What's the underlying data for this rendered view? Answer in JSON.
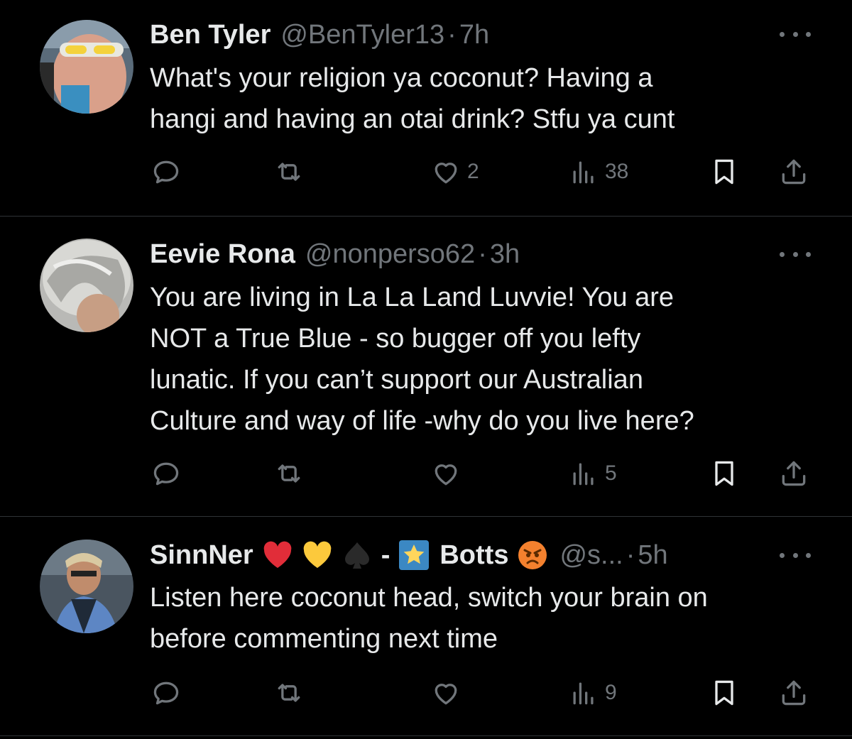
{
  "tweets": [
    {
      "name": "Ben Tyler",
      "handle": "@BenTyler13",
      "separator": "·",
      "time": "7h",
      "lines": [
        "What's your religion ya coconut? Having a",
        "hangi and having an otai drink? Stfu ya cunt"
      ],
      "likes": "2",
      "views": "38"
    },
    {
      "name": "Eevie Rona",
      "handle": "@nonperso62",
      "separator": "·",
      "time": "3h",
      "lines": [
        "You are living in La La Land Luvvie! You are",
        "NOT a True Blue - so bugger off you lefty",
        "lunatic. If you can’t support our Australian",
        "Culture and way of life -why do you live here?"
      ],
      "likes": "",
      "views": "5"
    },
    {
      "name_part1": "SinnNer",
      "name_dash": "-",
      "name_part2": "Botts",
      "name_emojis": [
        "red-heart",
        "yellow-heart",
        "spade-suit",
        "glowing-star",
        "angry-face"
      ],
      "handle": "@s...",
      "separator": "·",
      "time": "5h",
      "lines": [
        "Listen here coconut head, switch your brain on",
        "before commenting next time"
      ],
      "likes": "",
      "views": "9"
    }
  ],
  "icons": {
    "reply": "reply-icon",
    "retweet": "retweet-icon",
    "like": "heart-icon",
    "views": "views-icon",
    "bookmark": "bookmark-icon",
    "share": "share-icon",
    "more": "more-icon"
  },
  "colors": {
    "background": "#000000",
    "text": "#e7e9ea",
    "muted": "#71767b",
    "divider": "#2f3336"
  }
}
